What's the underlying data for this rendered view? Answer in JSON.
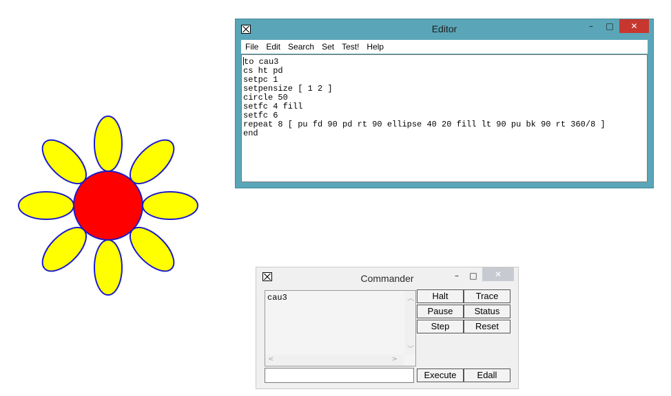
{
  "drawing": {
    "pen_color": "#1a1acc",
    "petal_fill": "#ffff00",
    "center_fill": "#ff0000",
    "petal_count": 8
  },
  "editor": {
    "title": "Editor",
    "controls": {
      "minimize": "–",
      "maximize": "□",
      "close": "✕"
    },
    "menu": [
      "File",
      "Edit",
      "Search",
      "Set",
      "Test!",
      "Help"
    ],
    "lines": [
      "to cau3",
      "cs ht pd",
      "setpc 1",
      "setpensize [ 1 2 ]",
      "circle 50",
      "setfc 4 fill",
      "setfc 6",
      "repeat 8 [ pu fd 90 pd rt 90 ellipse 40 20 fill lt 90 pu bk 90 rt 360/8 ]",
      "end"
    ]
  },
  "commander": {
    "title": "Commander",
    "controls": {
      "minimize": "–",
      "maximize": "□",
      "close": "✕"
    },
    "history": "cau3",
    "input_value": "",
    "buttons": {
      "halt": "Halt",
      "trace": "Trace",
      "pause": "Pause",
      "status": "Status",
      "step": "Step",
      "reset": "Reset",
      "execute": "Execute",
      "edall": "Edall"
    }
  },
  "colors": {
    "editor_frame": "#5aa6b8",
    "close_button": "#c7372f"
  }
}
